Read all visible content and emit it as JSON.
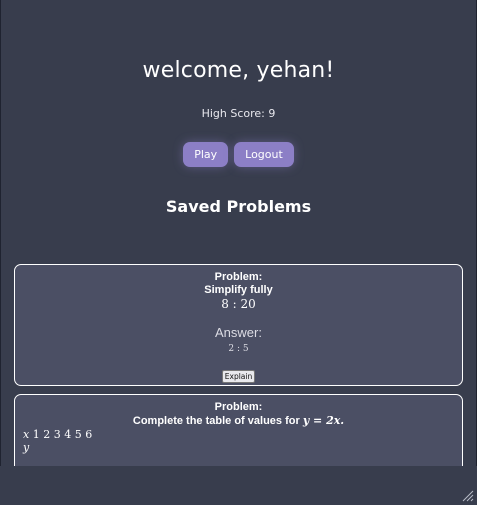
{
  "header": {
    "welcome": "welcome, yehan!",
    "high_score": "High Score: 9"
  },
  "actions": {
    "play_label": "Play",
    "logout_label": "Logout"
  },
  "saved": {
    "title": "Saved Problems",
    "problems": [
      {
        "label": "Problem:",
        "text": "Simplify fully",
        "expression": "8 : 20",
        "answer_label": "Answer:",
        "answer": "2 : 5",
        "explain_label": "Explain"
      },
      {
        "label": "Problem:",
        "text_prefix": "Complete the table of values for",
        "equation": "y = 2x.",
        "table_x_label": "x",
        "table_x_values": "1 2 3 4 5 6",
        "table_y_label": "y"
      }
    ]
  },
  "colors": {
    "background": "#383d4d",
    "card": "#4b4f64",
    "accent": "#8c7fc6"
  },
  "icons": {
    "resize": "resize-grip-icon"
  }
}
